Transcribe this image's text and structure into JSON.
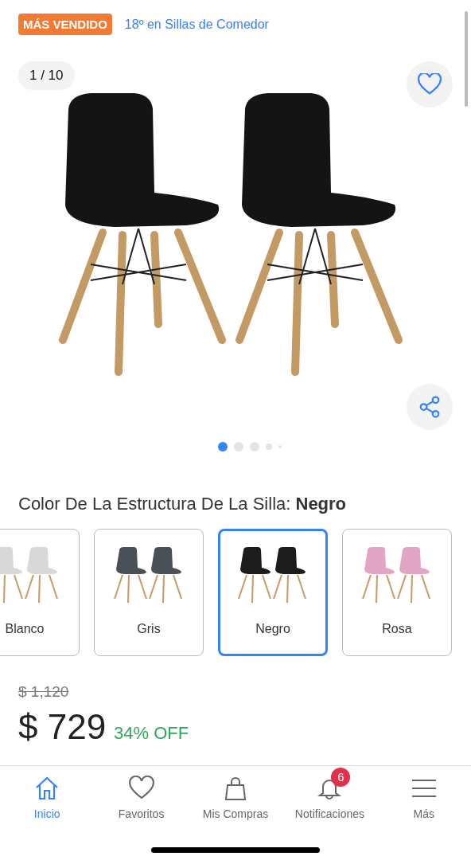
{
  "header": {
    "badge": "MÁS VENDIDO",
    "ranking_link": "18º en Sillas de Comedor"
  },
  "gallery": {
    "counter": "1 / 10",
    "favorite": false,
    "dots": [
      {
        "selected": true
      },
      {
        "selected": false
      },
      {
        "selected": false
      },
      {
        "selected": false
      },
      {
        "selected": false
      }
    ]
  },
  "variant": {
    "label": "Color De La Estructura De La Silla: ",
    "value": "Negro",
    "options": [
      {
        "label": "Blanco",
        "color": "#d8d8d8",
        "selected": false
      },
      {
        "label": "Gris",
        "color": "#4a5058",
        "selected": false
      },
      {
        "label": "Negro",
        "color": "#1c1c1c",
        "selected": true
      },
      {
        "label": "Rosa",
        "color": "#e2a6c4",
        "selected": false
      }
    ]
  },
  "price": {
    "original": "$ 1,120",
    "current": "$ 729",
    "discount": "34% OFF"
  },
  "bottom_nav": [
    {
      "kind": "home",
      "label": "Inicio",
      "selected": true
    },
    {
      "kind": "heart",
      "label": "Favoritos",
      "selected": false
    },
    {
      "kind": "bag",
      "label": "Mis Compras",
      "selected": false
    },
    {
      "kind": "bell",
      "label": "Notificaciones",
      "selected": false,
      "badge": "6"
    },
    {
      "kind": "menu",
      "label": "Más",
      "selected": false
    }
  ]
}
